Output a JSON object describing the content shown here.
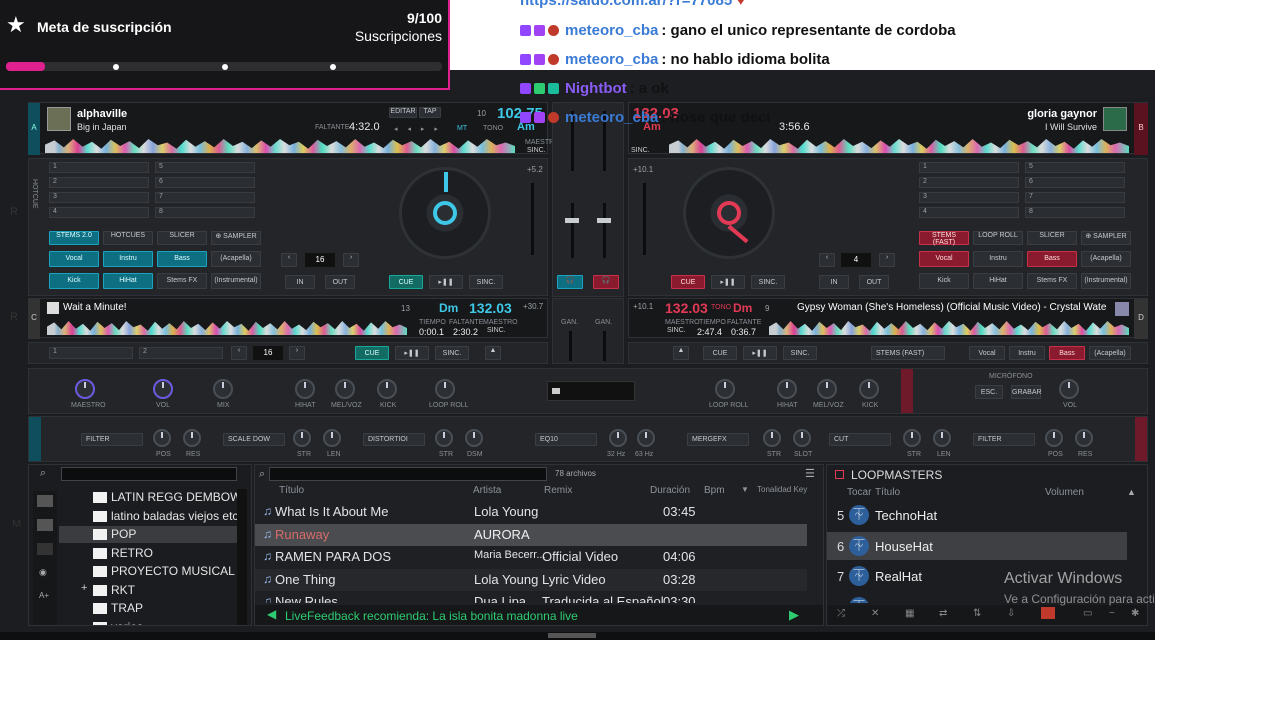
{
  "overlay": {
    "goal_title": "Meta de suscripción",
    "goal_count": "9/100",
    "goal_unit": "Suscripciones",
    "goal_progress": 0.09,
    "accent": "#e0208f"
  },
  "chat": {
    "top_link": "https://saldo.com.ar/?r=77085",
    "messages": [
      {
        "user": "meteoro_cba",
        "text": ": gano el unico representante de cordoba",
        "bot": false
      },
      {
        "user": "meteoro_cba",
        "text": ": no hablo idioma bolita",
        "bot": false
      },
      {
        "user": "Nightbot",
        "text": ": a ok",
        "bot": true
      },
      {
        "user": "meteoro_cba",
        "text": ": nose que deci",
        "bot": false
      }
    ]
  },
  "deck_a": {
    "letter": "A",
    "artist": "alphaville",
    "title": "Big in Japan",
    "remaining_label": "FALTANTE",
    "remaining": "4:32.0",
    "edit": "EDITAR",
    "tap": "TAP",
    "key_num": "10",
    "bpm": "102.75",
    "key": "Am",
    "mt": "MT",
    "tono": "TONO",
    "maestro": "MAESTRO",
    "sinc": "SINC.",
    "pitch": "+5.2",
    "cue": "CUE",
    "sync": "SINC.",
    "loop": "16",
    "in": "IN",
    "out": "OUT",
    "pad_modes": [
      "STEMS 2.0",
      "HOTCUES",
      "SLICER",
      "⊕ SAMPLER"
    ],
    "pads": [
      "Vocal",
      "Instru",
      "Bass",
      "(Acapella)",
      "Kick",
      "HiHat",
      "Stems FX",
      "(Instrumental)"
    ],
    "hotcues": [
      "1",
      "5",
      "2",
      "6",
      "3",
      "7",
      "4",
      "8"
    ],
    "side_labels": [
      "HOTCUE",
      "LOOP",
      "PADS"
    ]
  },
  "deck_b": {
    "letter": "B",
    "artist": "gloria gaynor",
    "title": "I Will Survive",
    "bpm": "132.03",
    "key": "Am",
    "elapsed": "3:56.6",
    "sinc": "SINC.",
    "pitch": "+10.1",
    "cue": "CUE",
    "sync": "SINC.",
    "loop": "4",
    "in": "IN",
    "out": "OUT",
    "pad_modes": [
      "STEMS (FAST)",
      "LOOP ROLL",
      "SLICER",
      "⊕ SAMPLER"
    ],
    "pads": [
      "Vocal",
      "Instru",
      "Bass",
      "(Acapella)",
      "Kick",
      "HiHat",
      "Stems FX",
      "(Instrumental)"
    ],
    "hotcues": [
      "1",
      "5",
      "2",
      "6",
      "3",
      "7",
      "4",
      "8"
    ]
  },
  "deck_c": {
    "letter": "C",
    "title": "Wait a Minute!",
    "key_num": "13",
    "key": "Dm",
    "bpm": "132.03",
    "tiempo_label": "TIEMPO",
    "faltante_label": "FALTANTE",
    "maestro_label": "MAESTRO",
    "tiempo": "0:00.1",
    "faltante": "2:30.2",
    "sinc": "SINC.",
    "pitch": "+30.7",
    "loop": "16",
    "cue": "CUE",
    "sync": "SINC.",
    "hotcues": [
      "1",
      "2"
    ]
  },
  "deck_d": {
    "letter": "D",
    "title": "Gypsy Woman (She's Homeless) (Official Music Video) - Crystal Wate",
    "bpm": "132.03",
    "tono": "TONO",
    "key": "Dm",
    "key_num": "9",
    "maestro_label": "MAESTRO",
    "tiempo_label": "TIEMPO",
    "faltante_label": "FALTANTE",
    "tiempo": "2:47.4",
    "faltante": "0:36.7",
    "sinc": "SINC.",
    "pitch": "+10.1",
    "cue": "CUE",
    "sync": "SINC.",
    "stems_mode": "STEMS (FAST)",
    "pads": [
      "Vocal",
      "Instru",
      "Bass",
      "(Acapella)"
    ]
  },
  "mixer": {
    "gan": "GAN.",
    "maestro": "MAESTRO",
    "vol": "VOL",
    "mix": "MIX",
    "hihat": "HIHAT",
    "melvoz": "MEL/VOZ",
    "kick": "KICK",
    "loop_roll": "LOOP ROLL",
    "microfono": "MICRÓFONO",
    "esc": "ESC.",
    "grabar": "GRABAR",
    "mic_vol": "VOL"
  },
  "fx": {
    "filter": "FILTER",
    "pos": "POS",
    "res": "RES",
    "scale_down": "SCALE DOW",
    "str": "STR",
    "len": "LEN",
    "distortion": "DISTORTIOI",
    "dsm": "DSM",
    "eq10": "EQ10",
    "hz32": "32 Hz",
    "hz63": "63 Hz",
    "mergefx": "MERGEFX",
    "slot": "SLOT",
    "cut": "CUT",
    "filter2": "FILTER"
  },
  "browser": {
    "folders": [
      {
        "name": "LATIN REGG DEMBOW BR AF",
        "selected": false
      },
      {
        "name": "latino baladas viejos etc",
        "selected": false
      },
      {
        "name": "POP",
        "selected": true
      },
      {
        "name": "RETRO",
        "selected": false
      },
      {
        "name": "PROYECTO MUSICAL",
        "selected": false
      },
      {
        "name": "RKT",
        "selected": false
      },
      {
        "name": "TRAP",
        "selected": false
      },
      {
        "name": "varios",
        "selected": false
      }
    ],
    "file_count": "78 archivos",
    "columns": [
      "Título",
      "Artista",
      "Remix",
      "Duración",
      "Bpm",
      "Tonalidad Key"
    ],
    "rows": [
      {
        "title": "What Is It About Me",
        "artist": "Lola Young",
        "remix": "",
        "duration": "03:45"
      },
      {
        "title": "Runaway",
        "artist": "AURORA",
        "remix": "",
        "duration": ""
      },
      {
        "title": "RAMEN PARA DOS",
        "artist": "Maria Becerr...",
        "remix": "Official Video",
        "duration": "04:06"
      },
      {
        "title": "One Thing",
        "artist": "Lola Young",
        "remix": "Lyric Video",
        "duration": "03:28"
      },
      {
        "title": "New Rules",
        "artist": "Dua Lipa",
        "remix": "Traducida al Español",
        "duration": "03:30"
      }
    ],
    "livefeedback": "LiveFeedback recomienda: La isla bonita madonna live"
  },
  "sampler": {
    "title": "LOOPMASTERS",
    "col_play": "Tocar",
    "col_title": "Título",
    "col_volume": "Volumen",
    "items": [
      {
        "num": "5",
        "name": "TechnoHat"
      },
      {
        "num": "6",
        "name": "HouseHat"
      },
      {
        "num": "7",
        "name": "RealHat"
      },
      {
        "num": "8",
        "name": "GarageHats"
      }
    ]
  },
  "watermark": {
    "title": "Activar Windows",
    "subtitle": "Ve a Configuración para activar Windows."
  }
}
